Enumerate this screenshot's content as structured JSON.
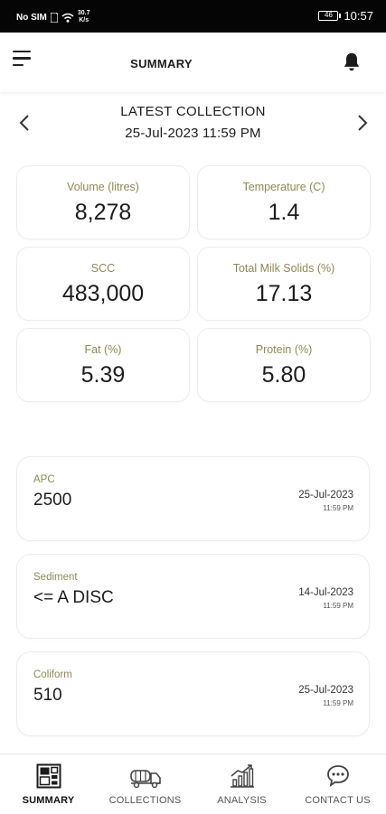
{
  "status_bar": {
    "carrier": "No SIM",
    "net_speed_value": "30.7",
    "net_speed_unit": "K/s",
    "battery": "46",
    "time": "10:57"
  },
  "header": {
    "title": "SUMMARY",
    "menu_icon": "hamburger-menu-icon",
    "notification_icon": "bell-icon"
  },
  "collection": {
    "title": "LATEST COLLECTION",
    "datetime": "25-Jul-2023 11:59 PM"
  },
  "metrics": [
    {
      "label": "Volume (litres)",
      "value": "8,278"
    },
    {
      "label": "Temperature (C)",
      "value": "1.4"
    },
    {
      "label": "SCC",
      "value": "483,000"
    },
    {
      "label": "Total Milk Solids (%)",
      "value": "17.13"
    },
    {
      "label": "Fat (%)",
      "value": "5.39"
    },
    {
      "label": "Protein (%)",
      "value": "5.80"
    }
  ],
  "tests": [
    {
      "label": "APC",
      "value": "2500",
      "date": "25-Jul-2023",
      "time": "11:59 PM"
    },
    {
      "label": "Sediment",
      "value": "<= A DISC",
      "date": "14-Jul-2023",
      "time": "11:59 PM"
    },
    {
      "label": "Coliform",
      "value": "510",
      "date": "25-Jul-2023",
      "time": "11:59 PM"
    }
  ],
  "bottom_nav": [
    {
      "label": "SUMMARY",
      "icon": "dashboard-icon",
      "active": true
    },
    {
      "label": "COLLECTIONS",
      "icon": "tanker-truck-icon",
      "active": false
    },
    {
      "label": "ANALYSIS",
      "icon": "bar-chart-icon",
      "active": false
    },
    {
      "label": "CONTACT US",
      "icon": "chat-bubble-icon",
      "active": false
    }
  ],
  "colors": {
    "label_olive": "#8d8a55",
    "status_bar": "#050505",
    "card_border": "#ececec"
  }
}
